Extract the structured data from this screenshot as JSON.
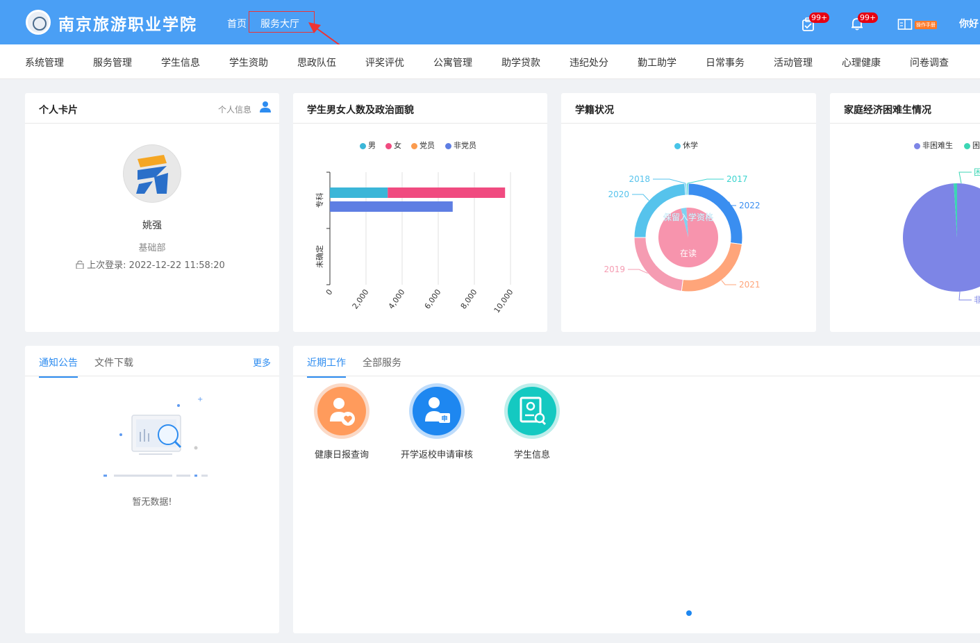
{
  "header": {
    "school_name": "南京旅游职业学院",
    "links": [
      "首页",
      "服务大厅"
    ],
    "badges": [
      "99+",
      "99+"
    ],
    "manual_label": "操作手册",
    "greeting": "你好"
  },
  "nav": {
    "items": [
      "系统管理",
      "服务管理",
      "学生信息",
      "学生资助",
      "思政队伍",
      "评奖评优",
      "公寓管理",
      "助学贷款",
      "违纪处分",
      "勤工助学",
      "日常事务",
      "活动管理",
      "心理健康",
      "问卷调查"
    ]
  },
  "profile": {
    "title": "个人卡片",
    "link": "个人信息",
    "name": "姚强",
    "department": "基础部",
    "last_login_label": "上次登录:",
    "last_login": "2022-12-22 11:58:20"
  },
  "notices": {
    "tabs": [
      "通知公告",
      "文件下载"
    ],
    "more": "更多",
    "empty": "暂无数据!"
  },
  "work": {
    "tabs": [
      "近期工作",
      "全部服务"
    ],
    "services": [
      {
        "label": "健康日报查询",
        "color": "#ff9b5c"
      },
      {
        "label": "开学返校申请审核",
        "color": "#1e87f0"
      },
      {
        "label": "学生信息",
        "color": "#14c9c1"
      }
    ]
  },
  "colors": {
    "header_bg": "#4a9ff5",
    "accent": "#2d8cf0"
  },
  "chart_data": [
    {
      "type": "bar",
      "title": "学生男女人数及政治面貌",
      "orientation": "horizontal",
      "categories": [
        "专科",
        "未确定"
      ],
      "series": [
        {
          "name": "男",
          "stack": "gender",
          "color": "#3bb6d8",
          "values": [
            3200,
            0
          ]
        },
        {
          "name": "女",
          "stack": "gender",
          "color": "#f04b80",
          "values": [
            6500,
            0
          ]
        },
        {
          "name": "党员",
          "stack": "party",
          "color": "#fb9b4e",
          "values": [
            0,
            0
          ]
        },
        {
          "name": "非党员",
          "stack": "party",
          "color": "#5e7ee3",
          "values": [
            6800,
            0
          ]
        }
      ],
      "xlim": [
        0,
        10000
      ],
      "xticks": [
        "0",
        "2,000",
        "4,000",
        "6,000",
        "8,000",
        "10,000"
      ],
      "legend_position": "top"
    },
    {
      "type": "pie",
      "title": "学籍状况",
      "legend": [
        {
          "name": "休学",
          "color": "#47c4e8"
        }
      ],
      "inner": [
        {
          "label": "保留入学资格",
          "value": 3,
          "color": "#7fd2f2"
        },
        {
          "label": "在读",
          "value": 97,
          "color": "#f794ad"
        }
      ],
      "outer": [
        {
          "label": "2022",
          "value": 27,
          "color": "#3a8ef0"
        },
        {
          "label": "2021",
          "value": 25,
          "color": "#ffa57a"
        },
        {
          "label": "2019",
          "value": 23,
          "color": "#f59cb2"
        },
        {
          "label": "2020",
          "value": 24,
          "color": "#56c3ec"
        },
        {
          "label": "2018",
          "value": 0.5,
          "color": "#56c3ec"
        },
        {
          "label": "2017",
          "value": 0.5,
          "color": "#3cd4cf"
        }
      ]
    },
    {
      "type": "pie",
      "title": "家庭经济困难生情况",
      "legend": [
        {
          "name": "非困难生",
          "color": "#7d85e6"
        },
        {
          "name": "困",
          "color": "#3cd6b4"
        }
      ],
      "slices": [
        {
          "label": "非",
          "value": 99,
          "color": "#7d85e6"
        },
        {
          "label": "困",
          "value": 1,
          "color": "#3cd6b4"
        }
      ]
    }
  ]
}
